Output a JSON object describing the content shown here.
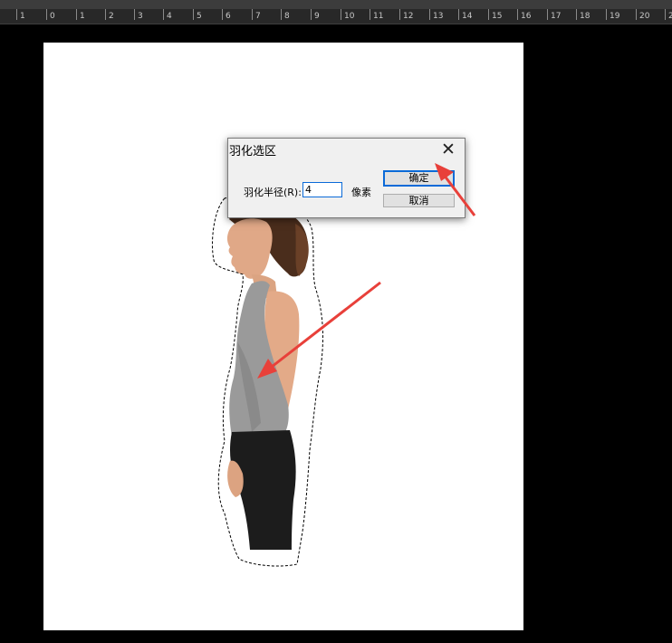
{
  "ruler": {
    "ticks": [
      "1",
      "0",
      "1",
      "2",
      "3",
      "4",
      "5",
      "6",
      "7",
      "8",
      "9",
      "10",
      "11",
      "12",
      "13",
      "14",
      "15",
      "16",
      "17",
      "18",
      "19",
      "20",
      "2"
    ]
  },
  "dialog": {
    "title": "羽化选区",
    "close_icon": "close-icon",
    "radius_label": "羽化半径(R):",
    "radius_value": "4",
    "unit_label": "像素",
    "ok_label": "确定",
    "cancel_label": "取消"
  },
  "colors": {
    "accent": "#0a6ad8",
    "annotation_arrow": "#e8403a",
    "canvas": "#ffffff",
    "workspace": "#000000"
  }
}
